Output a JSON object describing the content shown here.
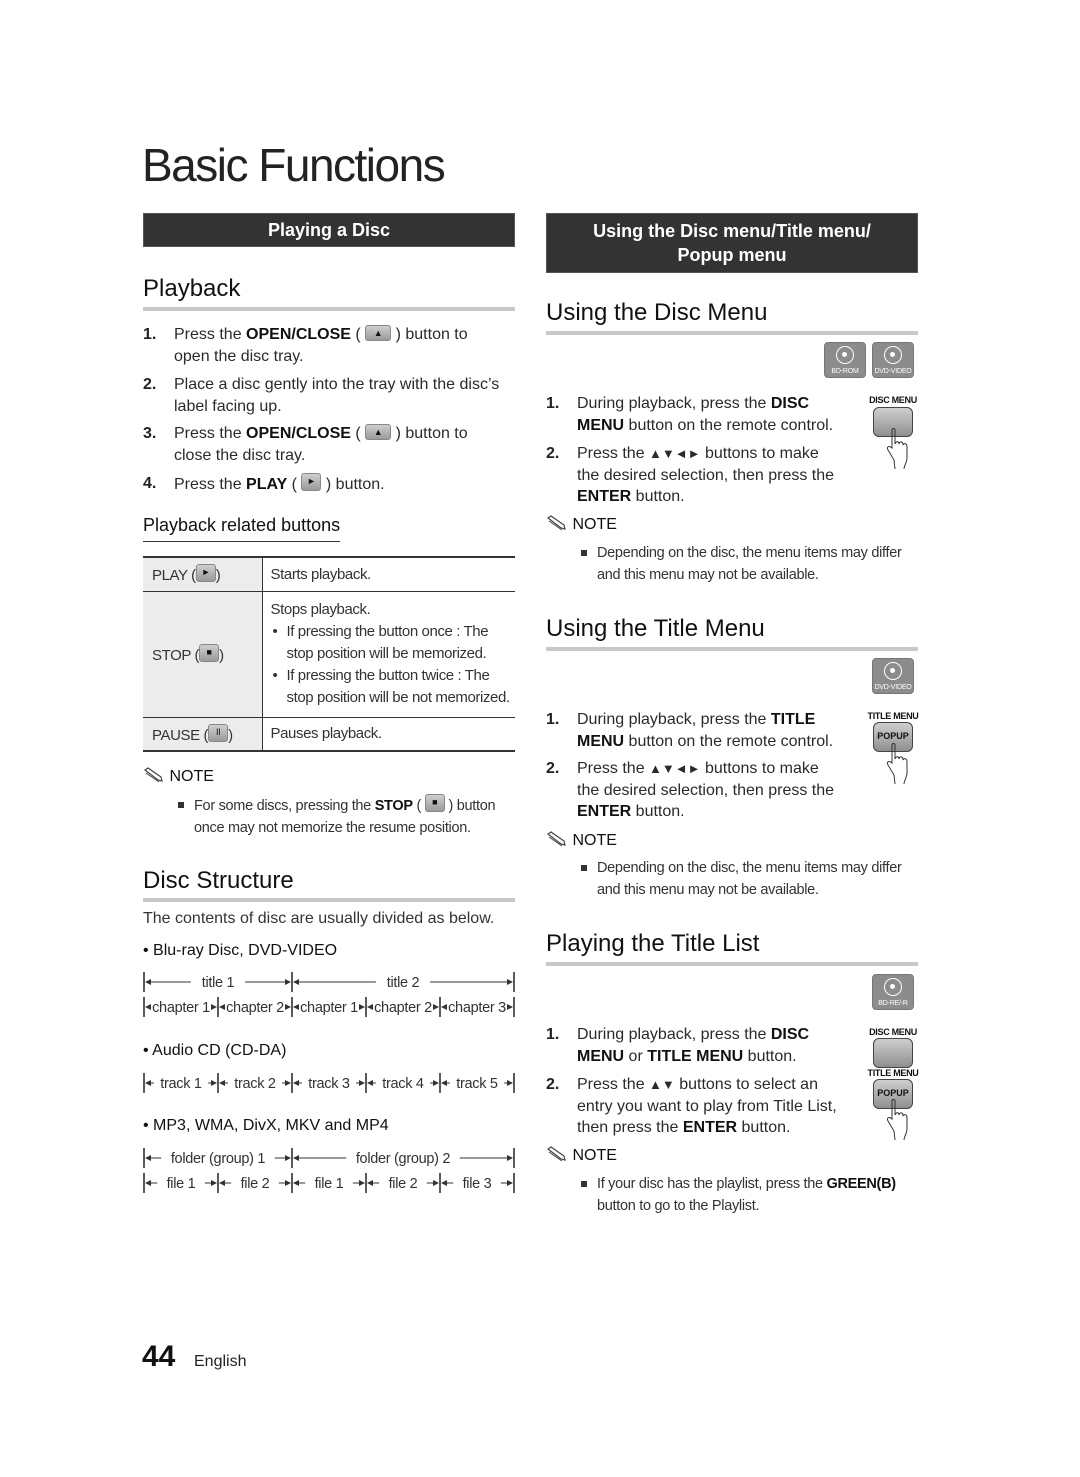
{
  "page": {
    "title": "Basic Functions",
    "page_number": "44",
    "language": "English"
  },
  "left": {
    "section_bar": "Playing a Disc",
    "playback": {
      "heading": "Playback",
      "steps": [
        {
          "num": "1.",
          "pre": "Press the ",
          "bold": "OPEN/CLOSE",
          "mid": " ( ",
          "icon": "eject",
          "post": " ) button to",
          "line2": "open the disc tray."
        },
        {
          "num": "2.",
          "line1": "Place a disc gently into the tray with the disc’s",
          "line2": "label facing up."
        },
        {
          "num": "3.",
          "pre": "Press the ",
          "bold": "OPEN/CLOSE",
          "mid": " ( ",
          "icon": "eject",
          "post": " ) button to",
          "line2": "close the disc tray."
        },
        {
          "num": "4.",
          "pre": "Press the ",
          "bold": "PLAY",
          "mid": " ( ",
          "icon": "play",
          "post": " ) button."
        }
      ],
      "related_heading": "Playback related buttons",
      "table": [
        {
          "key": "PLAY (",
          "icon": "play",
          "key_end": ")",
          "desc": "Starts playback."
        },
        {
          "key": "STOP (",
          "icon": "stop",
          "key_end": ")",
          "desc": "Stops playback.",
          "bullets": [
            "If pressing the button once : The stop position will be memorized.",
            "If pressing the button twice : The stop position will be not memorized."
          ]
        },
        {
          "key": "PAUSE (",
          "icon": "pause",
          "key_end": ")",
          "desc": "Pauses playback."
        }
      ],
      "note_label": "NOTE",
      "note": {
        "pre": "For some discs, pressing the ",
        "bold": "STOP",
        "mid": " ( ",
        "post": " ) button",
        "line2": "once may not memorize the resume position."
      }
    },
    "disc_structure": {
      "heading": "Disc Structure",
      "intro": "The contents of disc are usually divided as below.",
      "groups": [
        {
          "label": "Blu-ray Disc, DVD-VIDEO",
          "top": [
            "title 1",
            "title 2"
          ],
          "bottom": [
            "chapter 1",
            "chapter 2",
            "chapter 1",
            "chapter 2",
            "chapter 3"
          ]
        },
        {
          "label": "Audio CD (CD-DA)",
          "bottom": [
            "track 1",
            "track 2",
            "track 3",
            "track 4",
            "track 5"
          ]
        },
        {
          "label": "MP3, WMA, DivX, MKV and MP4",
          "top": [
            "folder (group) 1",
            "folder (group) 2"
          ],
          "bottom": [
            "file 1",
            "file 2",
            "file 1",
            "file 2",
            "file 3"
          ]
        }
      ]
    }
  },
  "right": {
    "section_bar_line1": "Using the Disc menu/Title menu/",
    "section_bar_line2": "Popup menu",
    "disc_menu": {
      "heading": "Using the Disc Menu",
      "badges": [
        "BD-ROM",
        "DVD-VIDEO"
      ],
      "remote_label": "DISC MENU",
      "steps": [
        {
          "num": "1.",
          "l1_pre": "During playback, press the ",
          "l1_bold": "DISC",
          "l2_bold": "MENU",
          "l2_post": " button on the remote control."
        },
        {
          "num": "2.",
          "l1_pre": "Press the ",
          "arrows": "▲▼◄►",
          "l1_post": " buttons to make",
          "l2": "the desired selection, then press the",
          "l3_bold": "ENTER",
          "l3_post": " button."
        }
      ],
      "note_label": "NOTE",
      "note_lines": [
        "Depending on the disc, the menu items may differ",
        "and this menu may not be available."
      ]
    },
    "title_menu": {
      "heading": "Using the Title Menu",
      "badges": [
        "DVD-VIDEO"
      ],
      "remote_label": "TITLE MENU",
      "remote_button": "POPUP",
      "steps": [
        {
          "num": "1.",
          "l1_pre": "During playback, press the ",
          "l1_bold": "TITLE",
          "l2_bold": "MENU",
          "l2_post": " button on the remote control."
        },
        {
          "num": "2.",
          "l1_pre": "Press the ",
          "arrows": "▲▼◄►",
          "l1_post": " buttons to make",
          "l2": "the desired selection, then press the",
          "l3_bold": "ENTER",
          "l3_post": " button."
        }
      ],
      "note_label": "NOTE",
      "note_lines": [
        "Depending on the disc, the menu items may differ",
        "and this menu may not be available."
      ]
    },
    "title_list": {
      "heading": "Playing the Title List",
      "badges": [
        "BD-RE/-R"
      ],
      "remote_label_1": "DISC MENU",
      "remote_label_2": "TITLE MENU",
      "remote_button": "POPUP",
      "steps": [
        {
          "num": "1.",
          "l1_pre": "During playback, press the ",
          "l1_bold": "DISC",
          "l2_bold": "MENU",
          "l2_mid": " or ",
          "l2_bold2": "TITLE MENU",
          "l2_post": " button."
        },
        {
          "num": "2.",
          "l1_pre": "Press the ",
          "arrows": "▲▼",
          "l1_post": " buttons to select an",
          "l2": "entry you want to play from Title List,",
          "l3_pre": "then press the ",
          "l3_bold": "ENTER",
          "l3_post": " button."
        }
      ],
      "note_label": "NOTE",
      "note": {
        "pre": "If your disc has the playlist, press the ",
        "bold": "GREEN(B)",
        "line2": "button to go to the Playlist."
      }
    }
  },
  "icons": {
    "eject": "▲",
    "play": "►",
    "stop": "■",
    "pause": "II"
  }
}
